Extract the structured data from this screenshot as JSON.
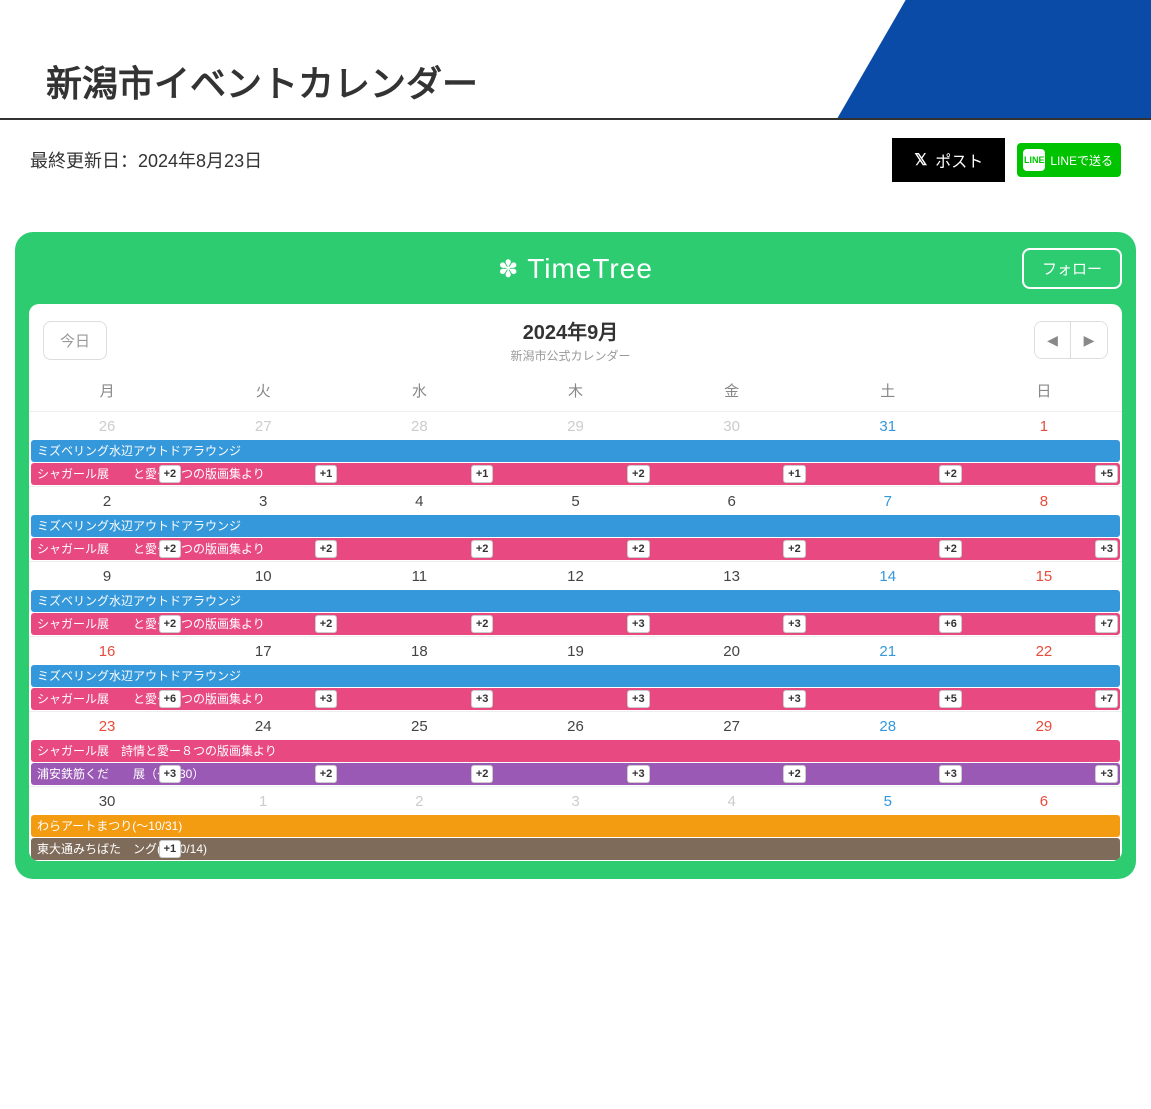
{
  "page": {
    "title": "新潟市イベントカレンダー",
    "updated_label": "最終更新日：2024年8月23日"
  },
  "share": {
    "post_label": "ポスト",
    "line_label": "LINEで送る",
    "line_icon_text": "LINE"
  },
  "timetree": {
    "brand": "TimeTree",
    "follow": "フォロー",
    "today": "今日",
    "month": "2024年9月",
    "subtitle": "新潟市公式カレンダー"
  },
  "weekdays": [
    "月",
    "火",
    "水",
    "木",
    "金",
    "土",
    "日"
  ],
  "weeks": [
    {
      "days": [
        {
          "n": "26",
          "cls": "prev-month"
        },
        {
          "n": "27",
          "cls": "prev-month"
        },
        {
          "n": "28",
          "cls": "prev-month"
        },
        {
          "n": "29",
          "cls": "prev-month"
        },
        {
          "n": "30",
          "cls": "prev-month"
        },
        {
          "n": "31",
          "cls": "prev-month sat"
        },
        {
          "n": "1",
          "cls": "sun"
        }
      ],
      "bars": [
        {
          "color": "blue",
          "left": 0,
          "right": 0,
          "text": "ミズベリング水辺アウトドアラウンジ"
        },
        {
          "color": "pink",
          "left": 0,
          "right": 0,
          "text": "シャガール展　　と愛ー８つの版画集より",
          "badges": [
            "+2",
            "+1",
            "+1",
            "+2",
            "+1",
            "+2",
            "+5"
          ]
        }
      ]
    },
    {
      "days": [
        {
          "n": "2",
          "cls": "cur"
        },
        {
          "n": "3",
          "cls": "cur"
        },
        {
          "n": "4",
          "cls": "cur"
        },
        {
          "n": "5",
          "cls": "cur"
        },
        {
          "n": "6",
          "cls": "cur"
        },
        {
          "n": "7",
          "cls": "sat"
        },
        {
          "n": "8",
          "cls": "sun"
        }
      ],
      "bars": [
        {
          "color": "blue",
          "left": 0,
          "right": 0,
          "text": "ミズベリング水辺アウトドアラウンジ"
        },
        {
          "color": "pink",
          "left": 0,
          "right": 0,
          "text": "シャガール展　　と愛ー８つの版画集より",
          "badges": [
            "+2",
            "+2",
            "+2",
            "+2",
            "+2",
            "+2",
            "+3"
          ]
        }
      ]
    },
    {
      "days": [
        {
          "n": "9",
          "cls": "cur"
        },
        {
          "n": "10",
          "cls": "cur"
        },
        {
          "n": "11",
          "cls": "cur"
        },
        {
          "n": "12",
          "cls": "cur"
        },
        {
          "n": "13",
          "cls": "cur"
        },
        {
          "n": "14",
          "cls": "sat"
        },
        {
          "n": "15",
          "cls": "sun"
        }
      ],
      "bars": [
        {
          "color": "blue",
          "left": 0,
          "right": 0,
          "text": "ミズベリング水辺アウトドアラウンジ"
        },
        {
          "color": "pink",
          "left": 0,
          "right": 0,
          "text": "シャガール展　　と愛ー８つの版画集より",
          "badges": [
            "+2",
            "+2",
            "+2",
            "+3",
            "+3",
            "+6",
            "+7"
          ]
        }
      ]
    },
    {
      "days": [
        {
          "n": "16",
          "cls": "holiday"
        },
        {
          "n": "17",
          "cls": "cur"
        },
        {
          "n": "18",
          "cls": "cur"
        },
        {
          "n": "19",
          "cls": "cur"
        },
        {
          "n": "20",
          "cls": "cur"
        },
        {
          "n": "21",
          "cls": "sat"
        },
        {
          "n": "22",
          "cls": "sun"
        }
      ],
      "bars": [
        {
          "color": "blue",
          "left": 0,
          "right": 0,
          "text": "ミズベリング水辺アウトドアラウンジ"
        },
        {
          "color": "pink",
          "left": 0,
          "right": 0,
          "text": "シャガール展　　と愛ー８つの版画集より",
          "badges": [
            "+6",
            "+3",
            "+3",
            "+3",
            "+3",
            "+5",
            "+7"
          ]
        }
      ]
    },
    {
      "days": [
        {
          "n": "23",
          "cls": "holiday"
        },
        {
          "n": "24",
          "cls": "cur"
        },
        {
          "n": "25",
          "cls": "cur"
        },
        {
          "n": "26",
          "cls": "cur"
        },
        {
          "n": "27",
          "cls": "cur"
        },
        {
          "n": "28",
          "cls": "sat"
        },
        {
          "n": "29",
          "cls": "sun"
        }
      ],
      "bars": [
        {
          "color": "pink",
          "left": 0,
          "right": 0,
          "text": "シャガール展　詩情と愛ー８つの版画集より"
        },
        {
          "color": "purple",
          "left": 0,
          "right": 0,
          "text": "浦安鉄筋くだ　　展（～9/30）",
          "badges": [
            "+3",
            "+2",
            "+2",
            "+3",
            "+2",
            "+3",
            "+3"
          ]
        }
      ]
    },
    {
      "days": [
        {
          "n": "30",
          "cls": "cur"
        },
        {
          "n": "1",
          "cls": "prev-month"
        },
        {
          "n": "2",
          "cls": "prev-month"
        },
        {
          "n": "3",
          "cls": "prev-month"
        },
        {
          "n": "4",
          "cls": "prev-month"
        },
        {
          "n": "5",
          "cls": "prev-month sat"
        },
        {
          "n": "6",
          "cls": "prev-month sun"
        }
      ],
      "bars": [
        {
          "color": "orange",
          "left": 0,
          "right": 0,
          "text": "わらアートまつり(～10/31)"
        },
        {
          "color": "brown",
          "left": 0,
          "right": 0,
          "text": "東大通みちばた　ング(～10/14)",
          "badges": [
            "+1",
            "",
            "",
            "",
            "",
            "",
            ""
          ]
        }
      ]
    }
  ]
}
